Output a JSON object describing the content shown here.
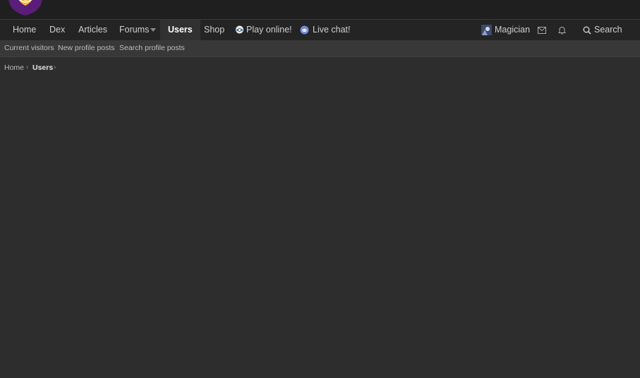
{
  "nav": {
    "items": [
      {
        "label": "Home"
      },
      {
        "label": "Dex"
      },
      {
        "label": "Articles"
      },
      {
        "label": "Forums"
      },
      {
        "label": "Users"
      },
      {
        "label": "Shop"
      },
      {
        "label": "Play online!",
        "icon": "showdown-icon"
      },
      {
        "label": "Live chat!",
        "icon": "discord-icon"
      }
    ],
    "active": "Users",
    "user": {
      "name": "Magician",
      "icon": "avatar"
    },
    "inbox_icon": "envelope-icon",
    "alerts_icon": "bell-icon",
    "search": {
      "label": "Search",
      "icon": "search-icon"
    }
  },
  "subnav": {
    "items": [
      "Current visitors",
      "New profile posts",
      "Search profile posts"
    ]
  },
  "breadcrumb": {
    "items": [
      "Home",
      "Users"
    ]
  },
  "colors": {
    "page_bg": "#2d2d2d",
    "topbar_bg": "#1f1f1f",
    "navbar_bg": "#242424",
    "subnav_bg": "#383838",
    "discord": "#7289da",
    "logo_purple": "#5a1d7a",
    "logo_gold": "#f4b43a"
  }
}
